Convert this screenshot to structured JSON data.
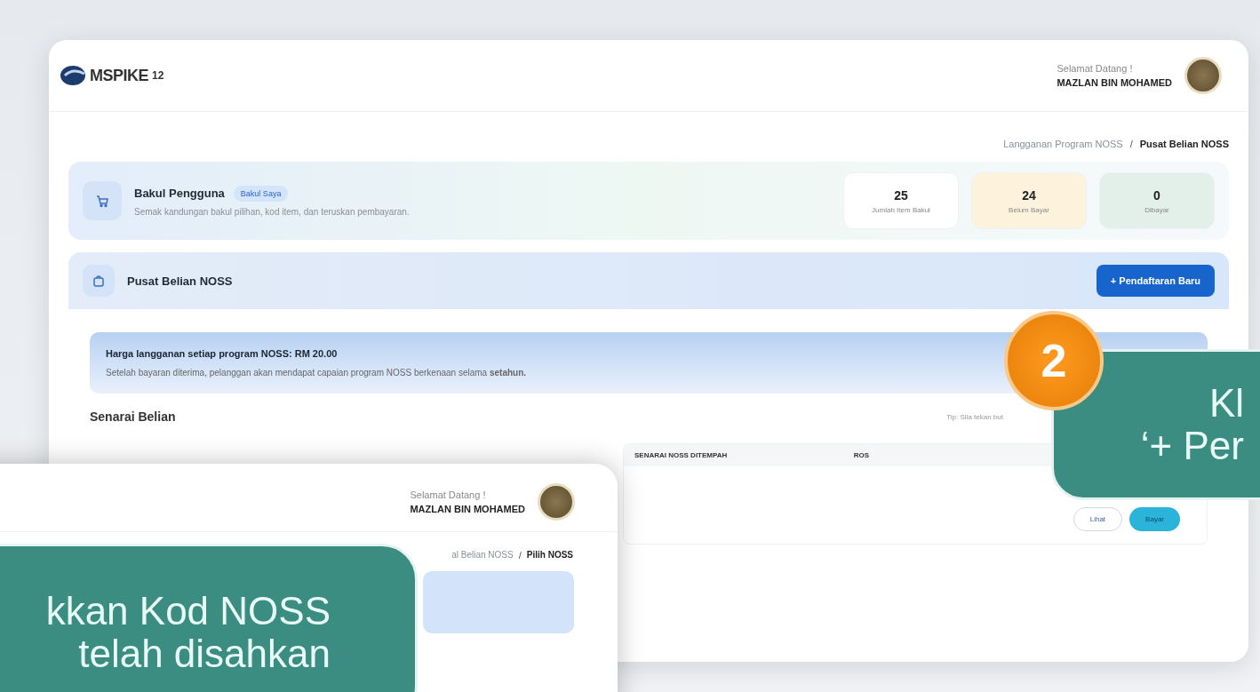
{
  "main_window": {
    "logo": {
      "text": "MSPIKE",
      "suffix": "12"
    },
    "user": {
      "greeting": "Selamat Datang !",
      "name": "MAZLAN BIN MOHAMED"
    },
    "breadcrumb_separator": "/",
    "breadcrumb": [
      {
        "label": "Langganan Program NOSS",
        "current": false
      },
      {
        "label": "Pusat Belian NOSS",
        "current": true
      }
    ],
    "cart": {
      "title": "Bakul Pengguna",
      "badge": "Bakul Saya",
      "description": "Semak kandungan bakul pilihan, kod item, dan teruskan pembayaran.",
      "stats": [
        {
          "value": "25",
          "label": "Jumlah Item Bakul",
          "color": "#ffffff"
        },
        {
          "value": "24",
          "label": "Belum Bayar",
          "color": "#fdf3dc"
        },
        {
          "value": "0",
          "label": "Dibayar",
          "color": "#e3efe9"
        }
      ]
    },
    "section": {
      "title": "Pusat Belian NOSS",
      "button": "+ Pendaftaran Baru"
    },
    "notice": {
      "title": "Harga langganan setiap program NOSS: RM 20.00",
      "text": "Setelah bayaran diterima, pelanggan akan mendapat capaian program NOSS berkenaan selama **setahun.**"
    },
    "list": {
      "title": "Senarai Belian",
      "tip": "Tip: Sila tekan but",
      "columns": [
        "SENARAI NOSS DITEMPAH",
        "ROS"
      ],
      "actions": [
        {
          "label": "Lihat",
          "kind": "outline"
        },
        {
          "label": "Bayar",
          "kind": "filled"
        }
      ]
    }
  },
  "second_window": {
    "breadcrumb_separator": "/",
    "user": {
      "greeting": "Selamat Datang !",
      "name": "MAZLAN BIN MOHAMED"
    },
    "breadcrumb": [
      {
        "label": "al Belian NOSS",
        "current": false
      },
      {
        "label": "Pilih NOSS",
        "current": true
      }
    ]
  },
  "callouts": [
    {
      "lines": [
        "kkan Kod NOSS",
        "telah disahkan"
      ],
      "kind": "left"
    },
    {
      "step": "2",
      "lines": [
        "Kl",
        "‘+ Per"
      ],
      "kind": "right"
    }
  ]
}
